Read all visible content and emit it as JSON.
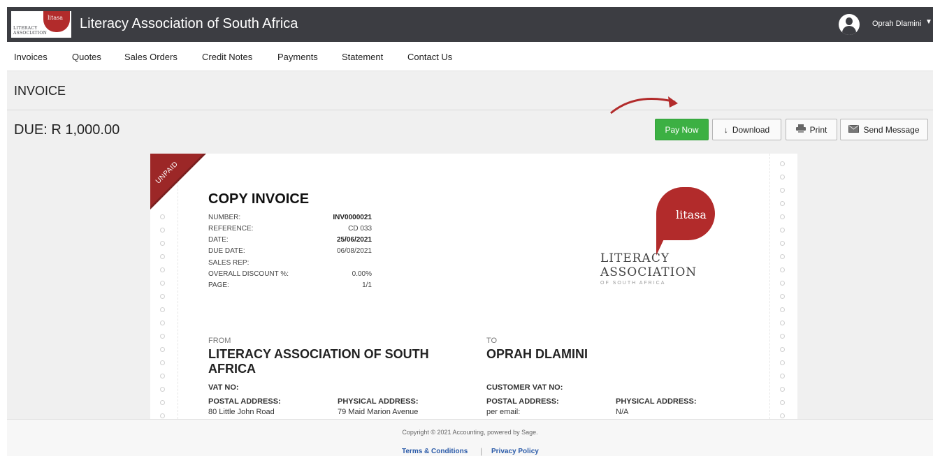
{
  "header": {
    "logo_bubble_text": "litasa",
    "logo_line1": "LITERACY",
    "logo_line2": "ASSOCIATION",
    "app_title": "Literacy Association of South Africa",
    "user_name": "Oprah Dlamini",
    "user_caret": "▼"
  },
  "nav": {
    "items": [
      {
        "label": "Invoices"
      },
      {
        "label": "Quotes"
      },
      {
        "label": "Sales Orders"
      },
      {
        "label": "Credit Notes"
      },
      {
        "label": "Payments"
      },
      {
        "label": "Statement"
      },
      {
        "label": "Contact Us"
      }
    ]
  },
  "page": {
    "title": "INVOICE",
    "due": "DUE: R 1,000.00"
  },
  "actions": {
    "pay_now": "Pay Now",
    "download": "Download",
    "print": "Print",
    "send_message": "Send Message"
  },
  "colors": {
    "header_bg": "#3c3d42",
    "pay_now_bg": "#3cb043",
    "brand_red": "#b22b2b",
    "footer_link": "#2a5aa8"
  },
  "icons": {
    "download": "download-arrow-icon",
    "print": "printer-icon",
    "send_message": "envelope-icon"
  },
  "invoice": {
    "status_ribbon": "UNPAID",
    "title": "COPY INVOICE",
    "meta": [
      {
        "label": "NUMBER:",
        "value": "INV0000021",
        "bold": true
      },
      {
        "label": "REFERENCE:",
        "value": "CD 033",
        "bold": false
      },
      {
        "label": "DATE:",
        "value": "25/06/2021",
        "bold": true
      },
      {
        "label": "DUE DATE:",
        "value": "06/08/2021",
        "bold": false
      },
      {
        "label": "SALES REP:",
        "value": "",
        "bold": false
      },
      {
        "label": "OVERALL DISCOUNT %:",
        "value": "0.00%",
        "bold": false
      },
      {
        "label": "PAGE:",
        "value": "1/1",
        "bold": false
      }
    ],
    "logo": {
      "bubble_text": "litasa",
      "line1": "LITERACY",
      "line2": "ASSOCIATION",
      "line3": "OF SOUTH AFRICA"
    },
    "from": {
      "label": "FROM",
      "name_line1": "LITERACY ASSOCIATION OF SOUTH",
      "name_line2": "AFRICA",
      "vat_label": "VAT NO:",
      "postal_label": "POSTAL ADDRESS:",
      "postal_value": "80 Little John Road",
      "physical_label": "PHYSICAL ADDRESS:",
      "physical_value": "79 Maid Marion Avenue"
    },
    "to": {
      "label": "TO",
      "name": "OPRAH DLAMINI",
      "vat_label": "CUSTOMER VAT NO:",
      "postal_label": "POSTAL ADDRESS:",
      "postal_value": "per email:",
      "physical_label": "PHYSICAL ADDRESS:",
      "physical_value": "N/A"
    }
  },
  "footer": {
    "copyright": "Copyright © 2021 Accounting, powered by Sage.",
    "terms": "Terms & Conditions",
    "separator": "|",
    "privacy": "Privacy Policy"
  }
}
